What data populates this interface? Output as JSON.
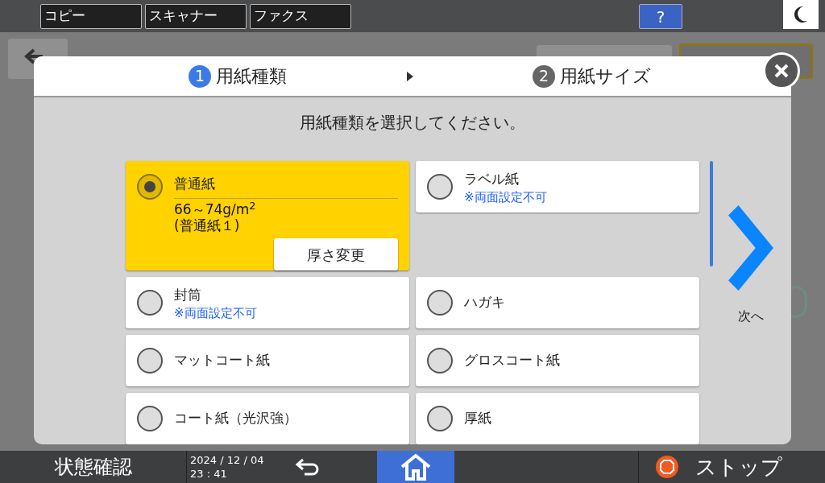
{
  "top_tabs": [
    {
      "label": "コピー"
    },
    {
      "label": "スキャナー"
    },
    {
      "label": "ファクス"
    }
  ],
  "help_button": {
    "label": "?"
  },
  "steps": [
    {
      "number": "1",
      "label": "用紙種類",
      "selected": true
    },
    {
      "number": "2",
      "label": "用紙サイズ",
      "selected": false
    }
  ],
  "prompt": "用紙種類を選択してください。",
  "paper_types": [
    {
      "label": "普通紙",
      "selected": true,
      "detail": "66～74g/m$^{2}$",
      "subdetail": "(普通紙１)",
      "action": "厚さ変更"
    },
    {
      "label": "ラベル紙",
      "note": "※両面設定不可",
      "selected": false
    },
    {
      "label": "封筒",
      "note": "※両面設定不可",
      "selected": false
    },
    {
      "label": "ハガキ",
      "selected": false
    },
    {
      "label": "マットコート紙",
      "selected": false
    },
    {
      "label": "グロスコート紙",
      "selected": false
    },
    {
      "label": "コート紙（光沢強）",
      "selected": false
    },
    {
      "label": "厚紙",
      "selected": false
    }
  ],
  "next_button": {
    "label": "次へ"
  },
  "status_button": {
    "label": "状態確認"
  },
  "datetime": {
    "date": "2024 / 12 / 04",
    "time": "23 : 41"
  },
  "stop_button": {
    "label": "ストップ"
  }
}
